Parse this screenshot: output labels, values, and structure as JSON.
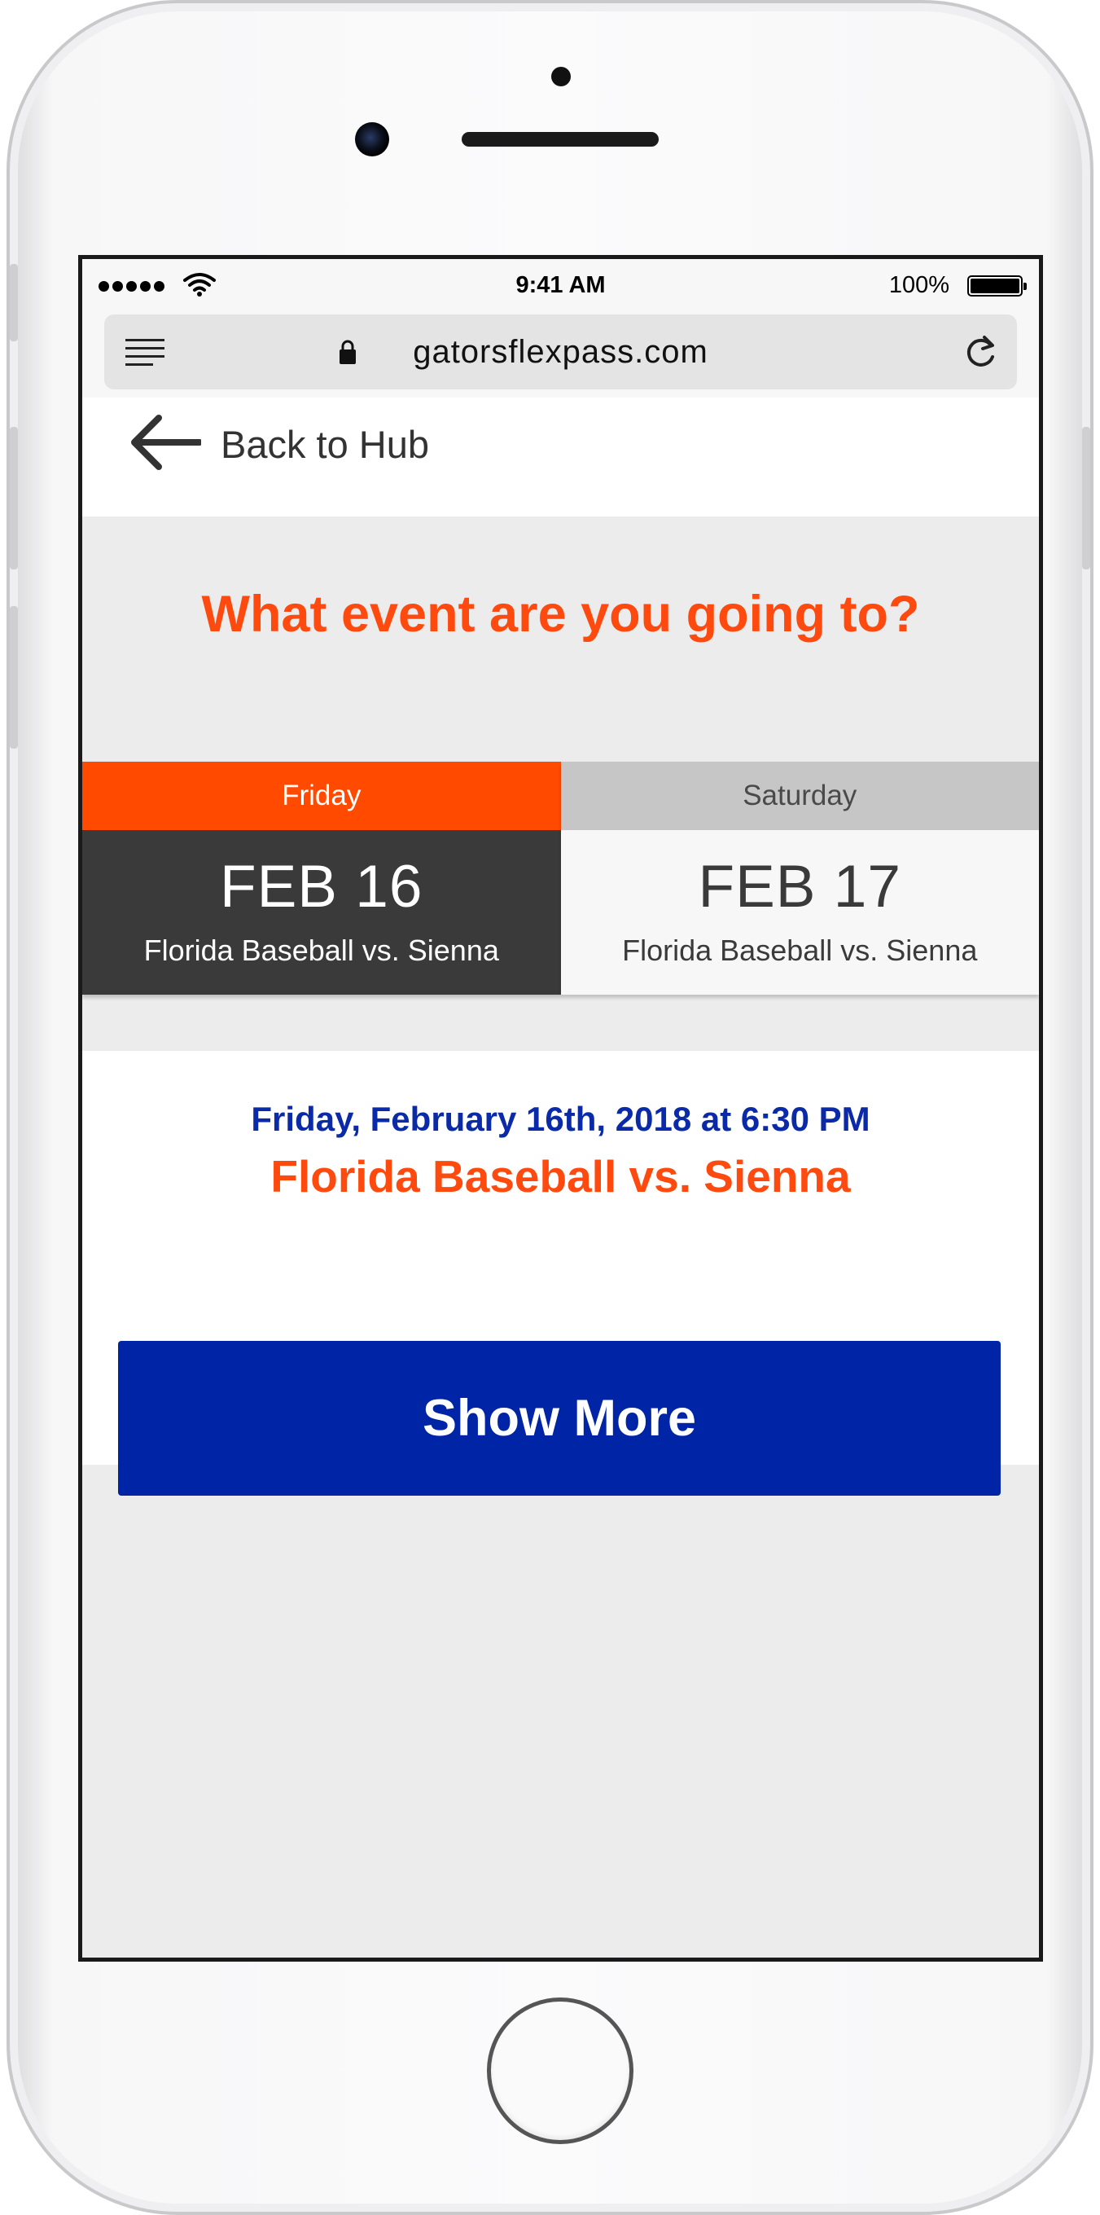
{
  "status_bar": {
    "time": "9:41 AM",
    "battery": "100%"
  },
  "browser": {
    "url": "gatorsflexpass.com",
    "icons": [
      "menu-icon",
      "lock-icon",
      "reload-icon"
    ]
  },
  "nav": {
    "back_label": "Back to Hub"
  },
  "page": {
    "question": "What event are you going to?",
    "tabs": [
      {
        "day": "Friday",
        "date": "FEB 16",
        "game": "Florida Baseball vs. Sienna",
        "selected": true
      },
      {
        "day": "Saturday",
        "date": "FEB 17",
        "game": "Florida Baseball vs. Sienna",
        "selected": false
      }
    ],
    "detail": {
      "datetime": "Friday, February 16th, 2018 at 6:30 PM",
      "game": "Florida Baseball vs. Sienna"
    },
    "show_more_label": "Show More"
  },
  "colors": {
    "accent_orange": "#ff4a0f",
    "accent_blue": "#0024a6",
    "selected_tab_body": "#3a3a3a"
  }
}
